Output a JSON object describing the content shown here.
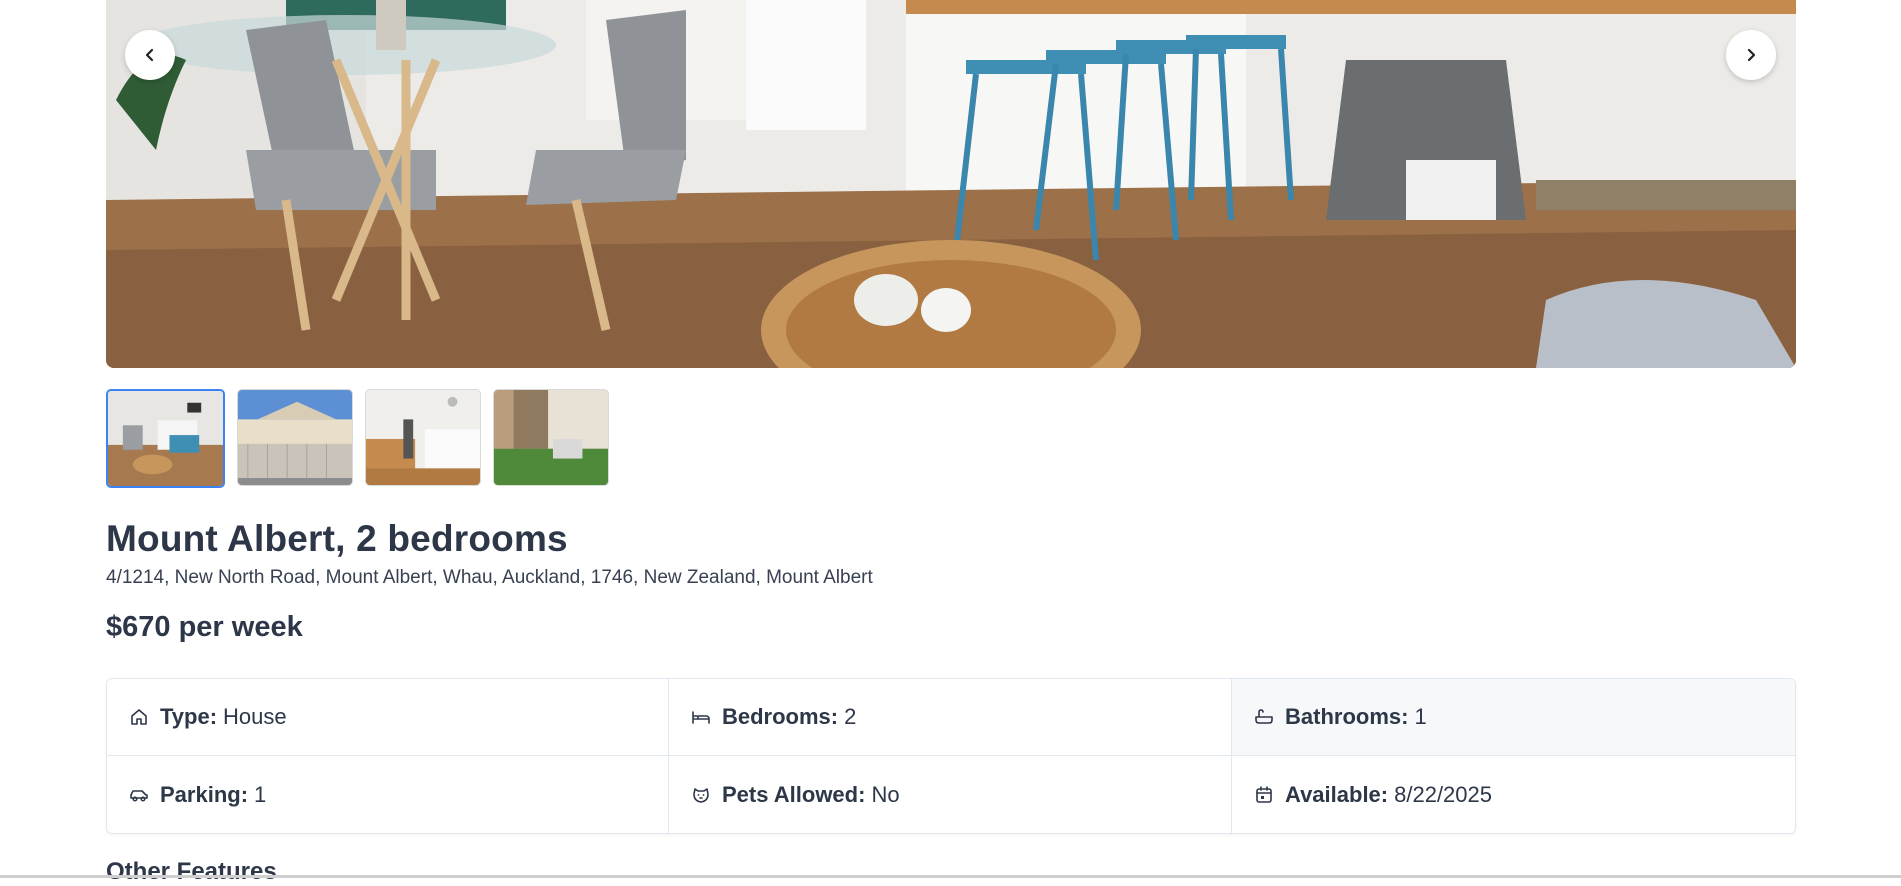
{
  "gallery": {
    "prev_label": "Previous image",
    "next_label": "Next image",
    "thumbnails": [
      {
        "alt": "Living and kitchen area",
        "active": true
      },
      {
        "alt": "Exterior with fence",
        "active": false
      },
      {
        "alt": "Kitchen",
        "active": false
      },
      {
        "alt": "Back yard",
        "active": false
      }
    ]
  },
  "listing": {
    "title": "Mount Albert, 2 bedrooms",
    "address": "4/1214, New North Road, Mount Albert, Whau, Auckland, 1746, New Zealand, Mount Albert",
    "price": "$670 per week"
  },
  "details": {
    "type": {
      "label": "Type:",
      "value": "House",
      "icon": "house-icon"
    },
    "bedrooms": {
      "label": "Bedrooms:",
      "value": "2",
      "icon": "bed-icon"
    },
    "bathrooms": {
      "label": "Bathrooms:",
      "value": "1",
      "icon": "bath-icon"
    },
    "parking": {
      "label": "Parking:",
      "value": "1",
      "icon": "car-icon"
    },
    "pets": {
      "label": "Pets Allowed:",
      "value": "No",
      "icon": "dog-icon"
    },
    "available": {
      "label": "Available:",
      "value": "8/22/2025",
      "icon": "calendar-icon"
    }
  },
  "sections": {
    "other_features": "Other Features"
  },
  "colors": {
    "accent": "#3b82f6",
    "text": "#2d3748",
    "border": "#e2e8f0"
  }
}
